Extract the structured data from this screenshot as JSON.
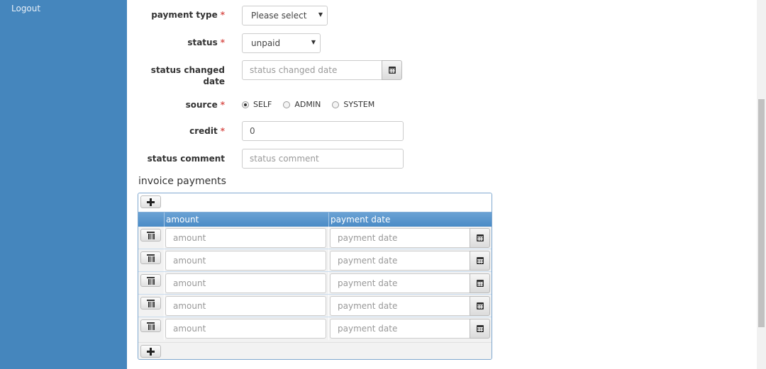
{
  "sidebar": {
    "logout_label": "Logout"
  },
  "form": {
    "payment_type": {
      "label": "payment type",
      "required_mark": "*",
      "value": "Please select"
    },
    "status": {
      "label": "status",
      "required_mark": "*",
      "value": "unpaid"
    },
    "status_changed_date": {
      "label_line1": "status changed",
      "label_line2": "date",
      "placeholder": "status changed date",
      "icon": "calendar-icon"
    },
    "source": {
      "label": "source",
      "required_mark": "*",
      "options": [
        {
          "label": "SELF",
          "checked": true
        },
        {
          "label": "ADMIN",
          "checked": false
        },
        {
          "label": "SYSTEM",
          "checked": false
        }
      ]
    },
    "credit": {
      "label": "credit",
      "required_mark": "*",
      "value": "0"
    },
    "status_comment": {
      "label": "status comment",
      "placeholder": "status comment"
    }
  },
  "invoice_payments": {
    "title": "invoice payments",
    "columns": [
      "amount",
      "payment date"
    ],
    "add_icon": "plus-icon",
    "delete_icon": "trash-icon",
    "rows": [
      {
        "amount_placeholder": "amount",
        "date_placeholder": "payment date"
      },
      {
        "amount_placeholder": "amount",
        "date_placeholder": "payment date"
      },
      {
        "amount_placeholder": "amount",
        "date_placeholder": "payment date"
      },
      {
        "amount_placeholder": "amount",
        "date_placeholder": "payment date"
      },
      {
        "amount_placeholder": "amount",
        "date_placeholder": "payment date"
      }
    ]
  },
  "colors": {
    "sidebar": "#4586bd",
    "grid_header": "#5a96cc",
    "required": "#d9534f"
  }
}
